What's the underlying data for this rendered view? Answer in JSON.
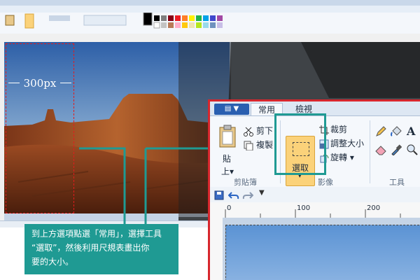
{
  "overlay": {
    "dimension_label": "300px",
    "instruction_lines": [
      "到上方選項點選「常用」，選擇工具",
      "“選取”，然後利用尺規表畫出你",
      "要的大小。"
    ]
  },
  "zoom": {
    "tabs": [
      "常用",
      "檢視"
    ],
    "clipboard": {
      "paste_label": "貼",
      "paste_sub": "上▾",
      "cut_label": "剪下",
      "copy_label": "複製",
      "group_label": "剪貼簿"
    },
    "image": {
      "select_label": "選取",
      "select_arrow": "▾",
      "crop_label": "裁剪",
      "resize_label": "調整大小",
      "rotate_label": "旋轉 ▾",
      "group_label": "影像"
    },
    "tools": {
      "group_label": "工具"
    },
    "ruler": {
      "ticks": [
        "0",
        "100",
        "200"
      ]
    }
  },
  "colors": {
    "callout_bg": "#1f9a93",
    "highlight_frame": "#d7262d",
    "select_button": "#fbd27a",
    "teal_frame": "#1f9a93"
  }
}
